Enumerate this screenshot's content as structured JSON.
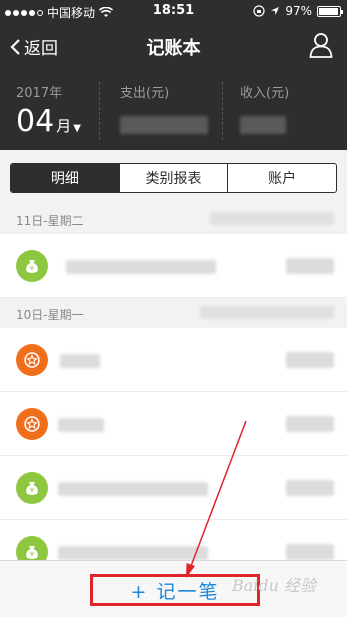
{
  "status_bar": {
    "carrier": "中国移动",
    "time": "18:51",
    "battery": "97%",
    "battery_level": 0.97
  },
  "nav": {
    "back_label": "返回",
    "title": "记账本"
  },
  "summary": {
    "year": "2017年",
    "month": "04",
    "month_suffix": "月",
    "expense_label": "支出(元)",
    "income_label": "收入(元)"
  },
  "tabs": [
    {
      "label": "明细",
      "active": true
    },
    {
      "label": "类别报表",
      "active": false
    },
    {
      "label": "账户",
      "active": false
    }
  ],
  "groups": [
    {
      "date": "11日-星期二",
      "entries": [
        {
          "icon": "money-bag-icon",
          "color": "#8dc63f"
        }
      ]
    },
    {
      "date": "10日-星期一",
      "entries": [
        {
          "icon": "star-badge-icon",
          "color": "#f06d1a"
        },
        {
          "icon": "star-badge-icon",
          "color": "#f06d1a"
        },
        {
          "icon": "money-bag-icon",
          "color": "#8dc63f"
        },
        {
          "icon": "money-bag-icon",
          "color": "#8dc63f"
        }
      ]
    }
  ],
  "bottom": {
    "add_label": "+ 记一笔",
    "highlight_color": "#e0252a"
  },
  "watermark": "Baidu 经验"
}
